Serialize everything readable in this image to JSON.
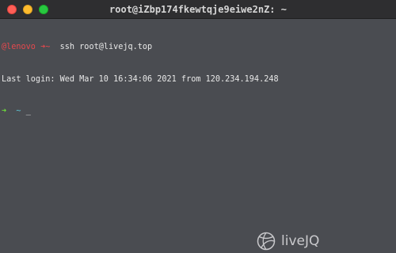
{
  "window": {
    "title": "root@iZbp174fkewtqje9eiwe2nZ: ~"
  },
  "terminal": {
    "line1": {
      "user": "@lenovo",
      "arrow": "➜",
      "tilde": "~",
      "command": "ssh root@livejq.top"
    },
    "line2": {
      "text": "Last login: Wed Mar 10 16:34:06 2021 from 120.234.194.248"
    },
    "line3": {
      "arrow": "➜",
      "tilde": "~",
      "cursor": "_"
    }
  },
  "watermark": {
    "text": "liveJQ",
    "icon": "basketball-icon"
  },
  "colors": {
    "titlebar": "#2e2e30",
    "background": "#4a4c51",
    "close": "#fe5f57",
    "minimize": "#febc2e",
    "zoom": "#28c840",
    "prompt_red": "#e5484d",
    "prompt_green": "#6fe03a",
    "prompt_cyan": "#5ec8d8"
  }
}
